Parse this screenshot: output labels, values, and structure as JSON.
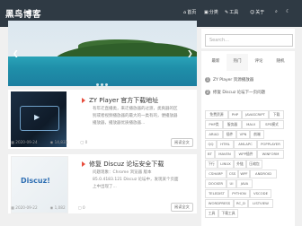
{
  "header": {
    "logo": "黑鸟博客",
    "nav": [
      {
        "icon": "home-icon",
        "glyph": "⌂",
        "label": "首页"
      },
      {
        "icon": "folder-icon",
        "glyph": "▣",
        "label": "分类"
      },
      {
        "icon": "tool-icon",
        "glyph": "✎",
        "label": "工具"
      },
      {
        "icon": "user-icon",
        "glyph": "☺",
        "label": "关于"
      }
    ]
  },
  "slider": {
    "prev": "❮",
    "next": "❯"
  },
  "posts": [
    {
      "title": "ZY Player 官方下载地址",
      "excerpt": "有年迁直播类，来迁播放器的过渡，类爽器的区别或者视频播放器的最大的一类有的，便播放器播放器，播放器优质播放器...",
      "date": "2020-09-24",
      "views": "14,831",
      "likes": "0",
      "read_more": "阅读全文"
    },
    {
      "title": "修复 Discuz 论坛安全下载",
      "excerpt": "问题现象：Chrome 浏览器 版本 85.0.4183.121 Discuz 论坛中，发现某个页面上中出现了...",
      "date": "2020-09-22",
      "views": "1,082",
      "likes": "0",
      "read_more": "阅读全文"
    }
  ],
  "sidebar": {
    "search_placeholder": "Search...",
    "tabs": [
      "最新",
      "热门",
      "评论",
      "随机"
    ],
    "hot_list": [
      "ZY Player 资源播放器",
      "修复 Discuz 论坛下一页问题"
    ],
    "tags": [
      "免费资源",
      "PHP",
      "JAVASCRIPT",
      "下载",
      "PHP类",
      "服务器",
      "MAUI",
      "SPS模式",
      "ARIA2",
      "插件",
      "VPN",
      "前端",
      "QQ",
      "HTML",
      "AMLAPC",
      "POPPLAYER",
      "BT",
      "MAVEN",
      "WPP插件",
      "WINFORM",
      "下行",
      "LINUX",
      "外链",
      "压缩包",
      "CSHARP",
      "CSS",
      "WPF",
      "ANDROID",
      "DOCKER",
      "UI",
      "JAVA",
      "TELEDIST",
      "PYTHON",
      "VSCODE",
      "WORDPRESS",
      "RC_D",
      "LISTVIEW",
      "工具",
      "下载工具"
    ]
  }
}
